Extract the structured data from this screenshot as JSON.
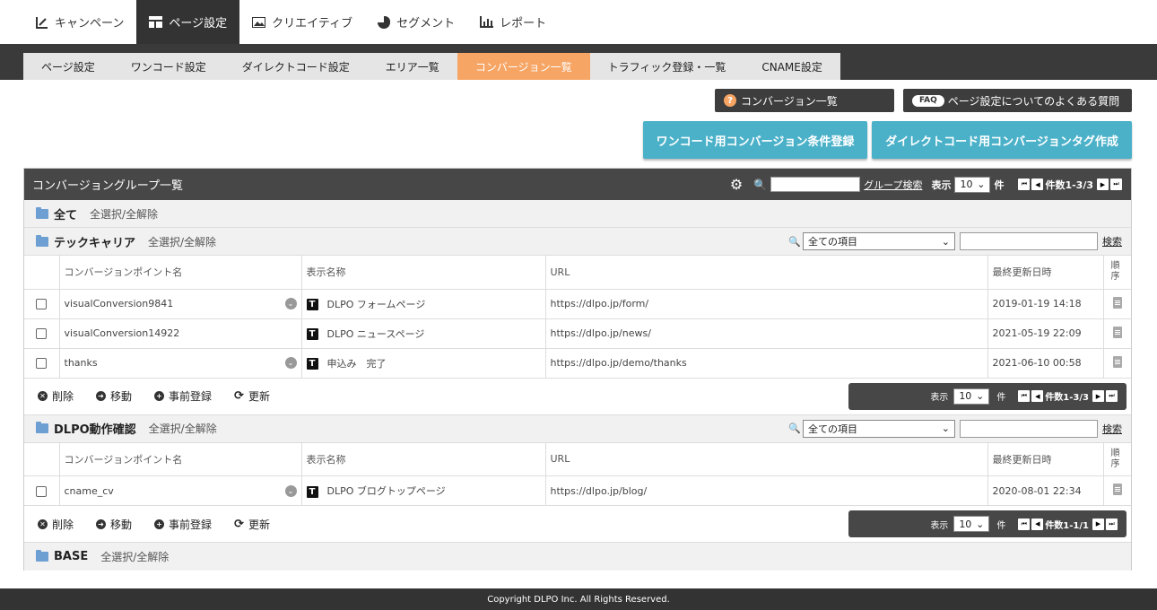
{
  "topnav": [
    {
      "label": "キャンペーン",
      "icon": "edit-chart-icon"
    },
    {
      "label": "ページ設定",
      "icon": "layout-icon"
    },
    {
      "label": "クリエイティブ",
      "icon": "image-icon"
    },
    {
      "label": "セグメント",
      "icon": "pie-chart-icon"
    },
    {
      "label": "レポート",
      "icon": "bar-chart-icon"
    }
  ],
  "subnav": [
    "ページ設定",
    "ワンコード設定",
    "ダイレクトコード設定",
    "エリア一覧",
    "コンバージョン一覧",
    "トラフィック登録・一覧",
    "CNAME設定"
  ],
  "help": {
    "conv_list": "コンバージョン一覧",
    "faq_badge": "FAQ",
    "faq_label": "ページ設定についてのよくある質問"
  },
  "buttons": {
    "onecode": "ワンコード用コンバージョン条件登録",
    "direct": "ダイレクトコード用コンバージョンタグ作成"
  },
  "panel": {
    "title": "コンバージョングループ一覧",
    "group_search": "グループ検索",
    "show": "表示",
    "per_page": "10",
    "unit": "件",
    "count": "件数1-3/3"
  },
  "all_group": {
    "name": "全て",
    "select": "全選択/全解除"
  },
  "table_headers": {
    "cp": "コンバージョンポイント名",
    "disp": "表示名称",
    "url": "URL",
    "updated": "最終更新日時",
    "order": "順序"
  },
  "groups": [
    {
      "name": "テックキャリア",
      "select": "全選択/全解除",
      "search_select": "全ての項目",
      "search_link": "検索",
      "rows": [
        {
          "cp": "visualConversion9841",
          "disp": "DLPO フォームページ",
          "url": "https://dlpo.jp/form/",
          "updated": "2019-01-19 14:18",
          "chev": true
        },
        {
          "cp": "visualConversion14922",
          "disp": "DLPO ニュースページ",
          "url": "https://dlpo.jp/news/",
          "updated": "2021-05-19 22:09",
          "chev": false
        },
        {
          "cp": "thanks",
          "disp": "申込み　完了",
          "url": "https://dlpo.jp/demo/thanks",
          "updated": "2021-06-10 00:58",
          "chev": true
        }
      ],
      "pager": {
        "show": "表示",
        "per": "10",
        "unit": "件",
        "count": "件数1-3/3"
      }
    },
    {
      "name": "DLPO動作確認",
      "select": "全選択/全解除",
      "search_select": "全ての項目",
      "search_link": "検索",
      "rows": [
        {
          "cp": "cname_cv",
          "disp": "DLPO ブログトップページ",
          "url": "https://dlpo.jp/blog/",
          "updated": "2020-08-01 22:34",
          "chev": true
        }
      ],
      "pager": {
        "show": "表示",
        "per": "10",
        "unit": "件",
        "count": "件数1-1/1"
      }
    }
  ],
  "actions": {
    "delete": "削除",
    "move": "移動",
    "pre": "事前登録",
    "refresh": "更新"
  },
  "base_group": {
    "name": "BASE",
    "select": "全選択/全解除"
  },
  "footer": "Copyright DLPO Inc. All Rights Reserved.",
  "colors": {
    "active_tab": "#f6a565",
    "teal": "#4bb1c9",
    "dark": "#474747"
  }
}
